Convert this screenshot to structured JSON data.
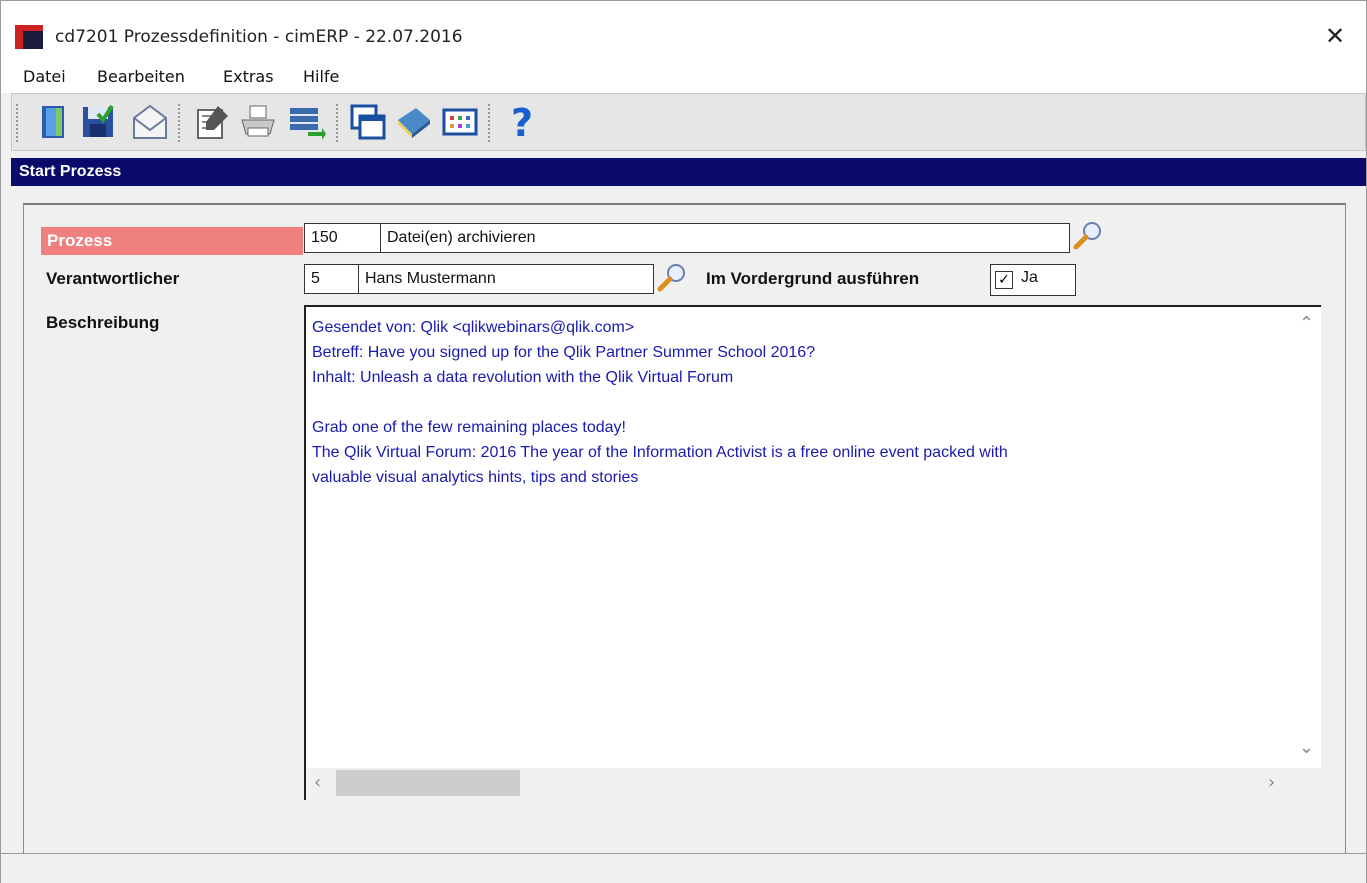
{
  "window": {
    "title": "cd7201 Prozessdefinition - cimERP - 22.07.2016",
    "close_glyph": "✕"
  },
  "menu": {
    "items": [
      "Datei",
      "Bearbeiten",
      "Extras",
      "Hilfe"
    ]
  },
  "toolbar": {
    "icons": [
      "exit-door-icon",
      "save-icon",
      "mail-icon",
      "edit-document-icon",
      "print-icon",
      "transfer-list-icon",
      "windows-icon",
      "book-icon",
      "table-grid-icon",
      "help-icon"
    ]
  },
  "section": {
    "title": "Start Prozess"
  },
  "form": {
    "prozess": {
      "label": "Prozess",
      "id_value": "150",
      "name_value": "Datei(en) archivieren"
    },
    "verantwortlicher": {
      "label": "Verantwortlicher",
      "id_value": "5",
      "name_value": "Hans Mustermann"
    },
    "vordergrund": {
      "label": "Im Vordergrund ausführen",
      "checked": true,
      "check_glyph": "✓",
      "value_label": "Ja"
    },
    "beschreibung": {
      "label": "Beschreibung",
      "lines": [
        "Gesendet von: Qlik <qlikwebinars@qlik.com>",
        "Betreff: Have you signed up for the Qlik Partner Summer School 2016?",
        "Inhalt: Unleash a data revolution with the Qlik Virtual Forum",
        "",
        "Grab one of the few remaining places today!",
        "The Qlik Virtual Forum: 2016 The year of the Information Activist is a free online event packed with",
        "valuable visual analytics hints, tips and stories"
      ]
    }
  },
  "colors": {
    "header_bg": "#0a0a6b",
    "label_highlight": "#f08080",
    "description_text": "#1a1ab0"
  }
}
